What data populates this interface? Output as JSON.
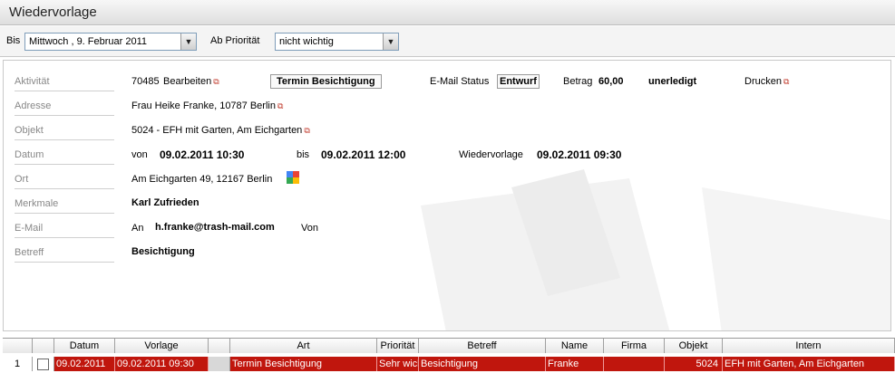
{
  "window": {
    "title": "Wiedervorlage"
  },
  "filter": {
    "bis_label": "Bis",
    "date_value": "Mittwoch , 9. Februar 2011",
    "priority_label": "Ab Priorität",
    "priority_value": "nicht wichtig"
  },
  "detail": {
    "aktivitaet": {
      "label": "Aktivität",
      "number": "70485",
      "edit_link": "Bearbeiten",
      "type_button": "Termin Besichtigung",
      "email_status_label": "E-Mail Status",
      "email_status_value": "Entwurf",
      "betrag_label": "Betrag",
      "betrag_value": "60,00",
      "state": "unerledigt",
      "print_link": "Drucken"
    },
    "adresse": {
      "label": "Adresse",
      "value": "Frau Heike Franke,  10787 Berlin"
    },
    "objekt": {
      "label": "Objekt",
      "value": "5024 - EFH mit Garten, Am Eichgarten"
    },
    "datum": {
      "label": "Datum",
      "von_label": "von",
      "von_value": "09.02.2011 10:30",
      "bis_label": "bis",
      "bis_value": "09.02.2011 12:00",
      "wv_label": "Wiedervorlage",
      "wv_value": "09.02.2011 09:30"
    },
    "ort": {
      "label": "Ort",
      "value": "Am Eichgarten 49, 12167 Berlin"
    },
    "merkmale": {
      "label": "Merkmale",
      "value": "Karl Zufrieden"
    },
    "email": {
      "label": "E-Mail",
      "an_label": "An",
      "an_value": "h.franke@trash-mail.com",
      "von_label": "Von"
    },
    "betreff": {
      "label": "Betreff",
      "value": "Besichtigung"
    }
  },
  "table": {
    "headers": [
      "",
      "",
      "Datum",
      "Vorlage",
      "",
      "Art",
      "Priorität",
      "Betreff",
      "Name",
      "Firma",
      "Objekt",
      "Intern"
    ],
    "rows": [
      {
        "num": "1",
        "datum": "09.02.2011",
        "vorlage": "09.02.2011 09:30",
        "art": "Termin Besichtigung",
        "prioritaet": "Sehr wichtig",
        "betreff": "Besichtigung",
        "name": "Franke",
        "firma": "",
        "objekt": "5024",
        "intern": "EFH mit Garten, Am Eichgarten"
      }
    ]
  },
  "colors": {
    "selected_row": "#c0160d",
    "link_icon": "#c0392b",
    "field_label": "#888888"
  }
}
